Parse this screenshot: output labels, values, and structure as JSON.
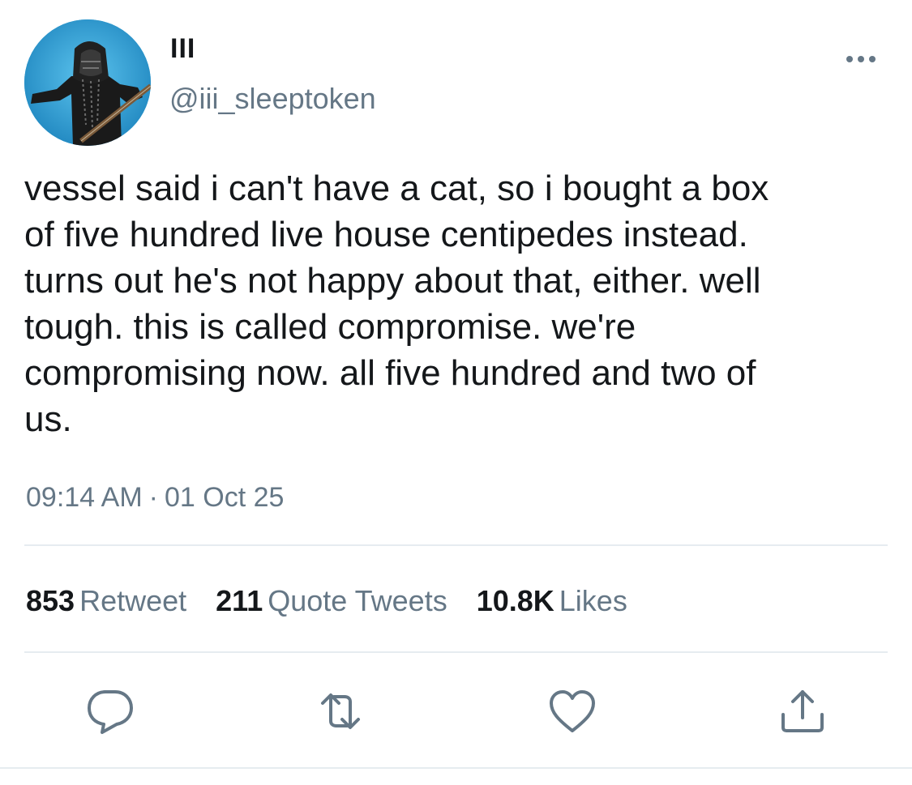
{
  "tweet": {
    "display_name": "III",
    "handle": "@iii_sleeptoken",
    "text": "vessel said i can't have a cat, so i bought a box\nof five hundred live house centipedes instead.\nturns out he's not happy about that, either. well\ntough. this is called compromise. we're\ncompromising now. all five hundred and two of\nus.",
    "time": "09:14 AM",
    "separator": "·",
    "date": "01 Oct 25"
  },
  "stats": {
    "retweets": {
      "count": "853",
      "label": "Retweet"
    },
    "quotes": {
      "count": "211",
      "label": "Quote Tweets"
    },
    "likes": {
      "count": "10.8K",
      "label": "Likes"
    }
  },
  "icons": {
    "more": "more-horizontal-icon",
    "reply": "reply-icon",
    "retweet": "retweet-icon",
    "like": "heart-icon",
    "share": "share-icon"
  },
  "colors": {
    "text": "#14171a",
    "secondary": "#657786",
    "divider": "#e6ecf0",
    "icon": "#657786"
  }
}
